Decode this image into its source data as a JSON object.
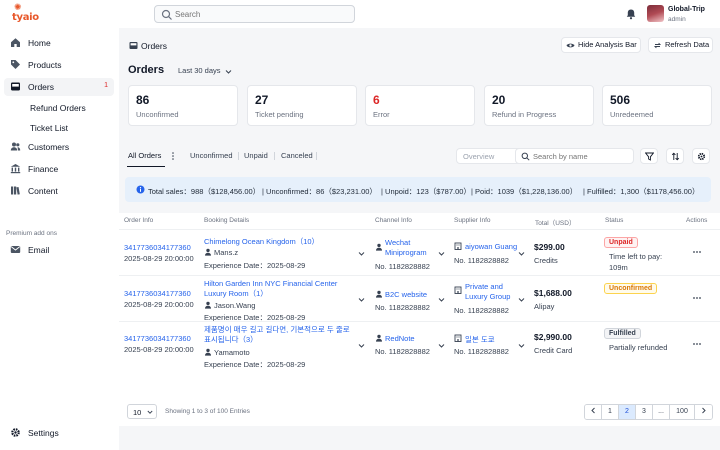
{
  "brand": {
    "logo_text": "tyaio"
  },
  "search": {
    "placeholder": "Search"
  },
  "user": {
    "name": "Global-Trip",
    "role": "admin"
  },
  "sidebar": {
    "items": [
      {
        "label": "Home"
      },
      {
        "label": "Products"
      },
      {
        "label": "Orders",
        "badge": "1"
      },
      {
        "label": "Refund Orders"
      },
      {
        "label": "Ticket List"
      },
      {
        "label": "Customers"
      },
      {
        "label": "Finance"
      },
      {
        "label": "Content"
      }
    ],
    "premium_label": "Premium add ons",
    "email_label": "Email",
    "settings_label": "Settings"
  },
  "header": {
    "breadcrumb": "Orders",
    "hide_analysis_label": "Hide Analysis Bar",
    "refresh_label": "Refresh Data",
    "title": "Orders",
    "date_range": "Last 30 days"
  },
  "stats": [
    {
      "value": "86",
      "label": "Unconfirmed"
    },
    {
      "value": "27",
      "label": "Ticket pending"
    },
    {
      "value": "6",
      "label": "Error"
    },
    {
      "value": "20",
      "label": "Refund in Progress"
    },
    {
      "value": "506",
      "label": "Unredeemed"
    }
  ],
  "tabs": {
    "all": "All Orders",
    "unconfirmed": "Unconfirmed",
    "unpaid": "Unpaid",
    "canceled": "Canceled"
  },
  "filters": {
    "overview": "Overview",
    "search_placeholder": "Search by name"
  },
  "summary": {
    "total": "Total sales：988（$128,456.00）",
    "unconfirmed": "| Unconfirmed：86（$23,231.00）",
    "unpaid": "| Unpoid：123（$787.00）",
    "paid": "| Poid：1039（$1,228,136.00）",
    "fulfilled": "| Fulfilled：1,300（$1178,456.00）"
  },
  "table": {
    "headers": {
      "order_info": "Order Info",
      "booking": "Booking Details",
      "channel": "Channel Info",
      "supplier": "Supplier Info",
      "total": "Total（USD）",
      "status": "Status",
      "actions": "Actions"
    },
    "rows": [
      {
        "order_id": "3417736034177360",
        "order_time": "2025-08-29 20:00:00",
        "booking_title": "Chimelong Ocean Kingdom（10）",
        "customer": "Mans.z",
        "experience": "Experience Date：2025-08-29",
        "channel_line1": "Wechat",
        "channel_line2": "Miniprogram",
        "channel_no": "No. 1182828882",
        "supplier_line1": "aiyowan Guang",
        "supplier_line2": "",
        "supplier_no": "No. 1182828882",
        "amount": "$299.00",
        "payment": "Credits",
        "status": "Unpaid",
        "status_note1": "Time left to pay:",
        "status_note2": "109m"
      },
      {
        "order_id": "3417736034177360",
        "order_time": "2025-08-29 20:00:00",
        "booking_title": "Hilton Garden Inn NYC Financial Center Luxury Room（1）",
        "customer": "Jason.Wang",
        "experience": "Experience Date：2025-08-29",
        "channel_line1": "B2C website",
        "channel_line2": "",
        "channel_no": "No. 1182828882",
        "supplier_line1": "Private and",
        "supplier_line2": "Luxury Group",
        "supplier_no": "No. 1182828882",
        "amount": "$1,688.00",
        "payment": "Alipay",
        "status": "Unconfirmed",
        "status_note1": "",
        "status_note2": ""
      },
      {
        "order_id": "3417736034177360",
        "order_time": "2025-08-29 20:00:00",
        "booking_title": "제품명이 매우 길고 길다면, 기본적으로 두 줄로 표시됩니다（3）",
        "customer": "Yamamoto",
        "experience": "Experience Date：2025-08-29",
        "channel_line1": "RedNote",
        "channel_line2": "",
        "channel_no": "No. 1182828882",
        "supplier_line1": "일본 도쿄",
        "supplier_line2": "",
        "supplier_no": "No. 1182828882",
        "amount": "$2,990.00",
        "payment": "Credit Card",
        "status": "Fulfilled",
        "status_note1": "Partially refunded",
        "status_note2": ""
      }
    ]
  },
  "pagination": {
    "page_size": "10",
    "showing": "Showing 1 to 3 of 100 Entries",
    "pages": [
      "1",
      "2",
      "3",
      "...",
      "100"
    ],
    "current": "2"
  },
  "colors": {
    "brand": "#e8582b",
    "link": "#2563eb",
    "error": "#dc2626",
    "info_bg": "#e6f0fb"
  }
}
